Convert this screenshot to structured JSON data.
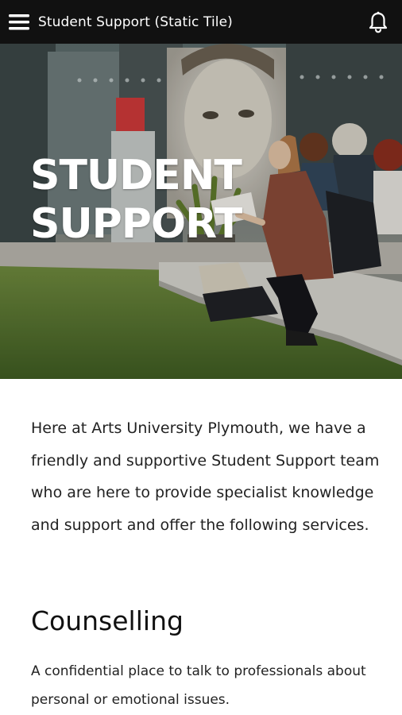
{
  "header": {
    "title": "Student Support (Static Tile)",
    "menu_icon": "hamburger-menu-icon",
    "notifications_icon": "bell-icon"
  },
  "hero": {
    "title_line1": "STUDENT",
    "title_line2": "SUPPORT"
  },
  "content": {
    "intro": "Here at Arts University Plymouth, we have a friendly and supportive Student Support team who are here to provide specialist knowledge and support and offer the following services.",
    "sections": [
      {
        "heading": "Counselling",
        "text": "A confidential place to talk to professionals about personal or emotional issues."
      }
    ]
  },
  "colors": {
    "appbar": "#111111",
    "text": "#222222"
  }
}
